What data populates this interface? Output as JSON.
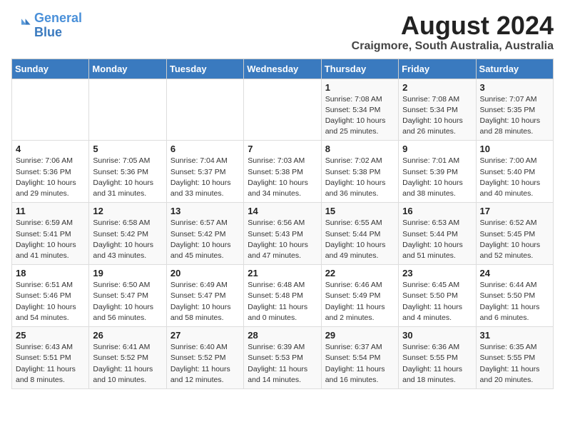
{
  "header": {
    "logo_line1": "General",
    "logo_line2": "Blue",
    "title": "August 2024",
    "subtitle": "Craigmore, South Australia, Australia"
  },
  "calendar": {
    "days_of_week": [
      "Sunday",
      "Monday",
      "Tuesday",
      "Wednesday",
      "Thursday",
      "Friday",
      "Saturday"
    ],
    "weeks": [
      [
        {
          "day": "",
          "info": ""
        },
        {
          "day": "",
          "info": ""
        },
        {
          "day": "",
          "info": ""
        },
        {
          "day": "",
          "info": ""
        },
        {
          "day": "1",
          "info": "Sunrise: 7:08 AM\nSunset: 5:34 PM\nDaylight: 10 hours\nand 25 minutes."
        },
        {
          "day": "2",
          "info": "Sunrise: 7:08 AM\nSunset: 5:34 PM\nDaylight: 10 hours\nand 26 minutes."
        },
        {
          "day": "3",
          "info": "Sunrise: 7:07 AM\nSunset: 5:35 PM\nDaylight: 10 hours\nand 28 minutes."
        }
      ],
      [
        {
          "day": "4",
          "info": "Sunrise: 7:06 AM\nSunset: 5:36 PM\nDaylight: 10 hours\nand 29 minutes."
        },
        {
          "day": "5",
          "info": "Sunrise: 7:05 AM\nSunset: 5:36 PM\nDaylight: 10 hours\nand 31 minutes."
        },
        {
          "day": "6",
          "info": "Sunrise: 7:04 AM\nSunset: 5:37 PM\nDaylight: 10 hours\nand 33 minutes."
        },
        {
          "day": "7",
          "info": "Sunrise: 7:03 AM\nSunset: 5:38 PM\nDaylight: 10 hours\nand 34 minutes."
        },
        {
          "day": "8",
          "info": "Sunrise: 7:02 AM\nSunset: 5:38 PM\nDaylight: 10 hours\nand 36 minutes."
        },
        {
          "day": "9",
          "info": "Sunrise: 7:01 AM\nSunset: 5:39 PM\nDaylight: 10 hours\nand 38 minutes."
        },
        {
          "day": "10",
          "info": "Sunrise: 7:00 AM\nSunset: 5:40 PM\nDaylight: 10 hours\nand 40 minutes."
        }
      ],
      [
        {
          "day": "11",
          "info": "Sunrise: 6:59 AM\nSunset: 5:41 PM\nDaylight: 10 hours\nand 41 minutes."
        },
        {
          "day": "12",
          "info": "Sunrise: 6:58 AM\nSunset: 5:42 PM\nDaylight: 10 hours\nand 43 minutes."
        },
        {
          "day": "13",
          "info": "Sunrise: 6:57 AM\nSunset: 5:42 PM\nDaylight: 10 hours\nand 45 minutes."
        },
        {
          "day": "14",
          "info": "Sunrise: 6:56 AM\nSunset: 5:43 PM\nDaylight: 10 hours\nand 47 minutes."
        },
        {
          "day": "15",
          "info": "Sunrise: 6:55 AM\nSunset: 5:44 PM\nDaylight: 10 hours\nand 49 minutes."
        },
        {
          "day": "16",
          "info": "Sunrise: 6:53 AM\nSunset: 5:44 PM\nDaylight: 10 hours\nand 51 minutes."
        },
        {
          "day": "17",
          "info": "Sunrise: 6:52 AM\nSunset: 5:45 PM\nDaylight: 10 hours\nand 52 minutes."
        }
      ],
      [
        {
          "day": "18",
          "info": "Sunrise: 6:51 AM\nSunset: 5:46 PM\nDaylight: 10 hours\nand 54 minutes."
        },
        {
          "day": "19",
          "info": "Sunrise: 6:50 AM\nSunset: 5:47 PM\nDaylight: 10 hours\nand 56 minutes."
        },
        {
          "day": "20",
          "info": "Sunrise: 6:49 AM\nSunset: 5:47 PM\nDaylight: 10 hours\nand 58 minutes."
        },
        {
          "day": "21",
          "info": "Sunrise: 6:48 AM\nSunset: 5:48 PM\nDaylight: 11 hours\nand 0 minutes."
        },
        {
          "day": "22",
          "info": "Sunrise: 6:46 AM\nSunset: 5:49 PM\nDaylight: 11 hours\nand 2 minutes."
        },
        {
          "day": "23",
          "info": "Sunrise: 6:45 AM\nSunset: 5:50 PM\nDaylight: 11 hours\nand 4 minutes."
        },
        {
          "day": "24",
          "info": "Sunrise: 6:44 AM\nSunset: 5:50 PM\nDaylight: 11 hours\nand 6 minutes."
        }
      ],
      [
        {
          "day": "25",
          "info": "Sunrise: 6:43 AM\nSunset: 5:51 PM\nDaylight: 11 hours\nand 8 minutes."
        },
        {
          "day": "26",
          "info": "Sunrise: 6:41 AM\nSunset: 5:52 PM\nDaylight: 11 hours\nand 10 minutes."
        },
        {
          "day": "27",
          "info": "Sunrise: 6:40 AM\nSunset: 5:52 PM\nDaylight: 11 hours\nand 12 minutes."
        },
        {
          "day": "28",
          "info": "Sunrise: 6:39 AM\nSunset: 5:53 PM\nDaylight: 11 hours\nand 14 minutes."
        },
        {
          "day": "29",
          "info": "Sunrise: 6:37 AM\nSunset: 5:54 PM\nDaylight: 11 hours\nand 16 minutes."
        },
        {
          "day": "30",
          "info": "Sunrise: 6:36 AM\nSunset: 5:55 PM\nDaylight: 11 hours\nand 18 minutes."
        },
        {
          "day": "31",
          "info": "Sunrise: 6:35 AM\nSunset: 5:55 PM\nDaylight: 11 hours\nand 20 minutes."
        }
      ]
    ]
  }
}
